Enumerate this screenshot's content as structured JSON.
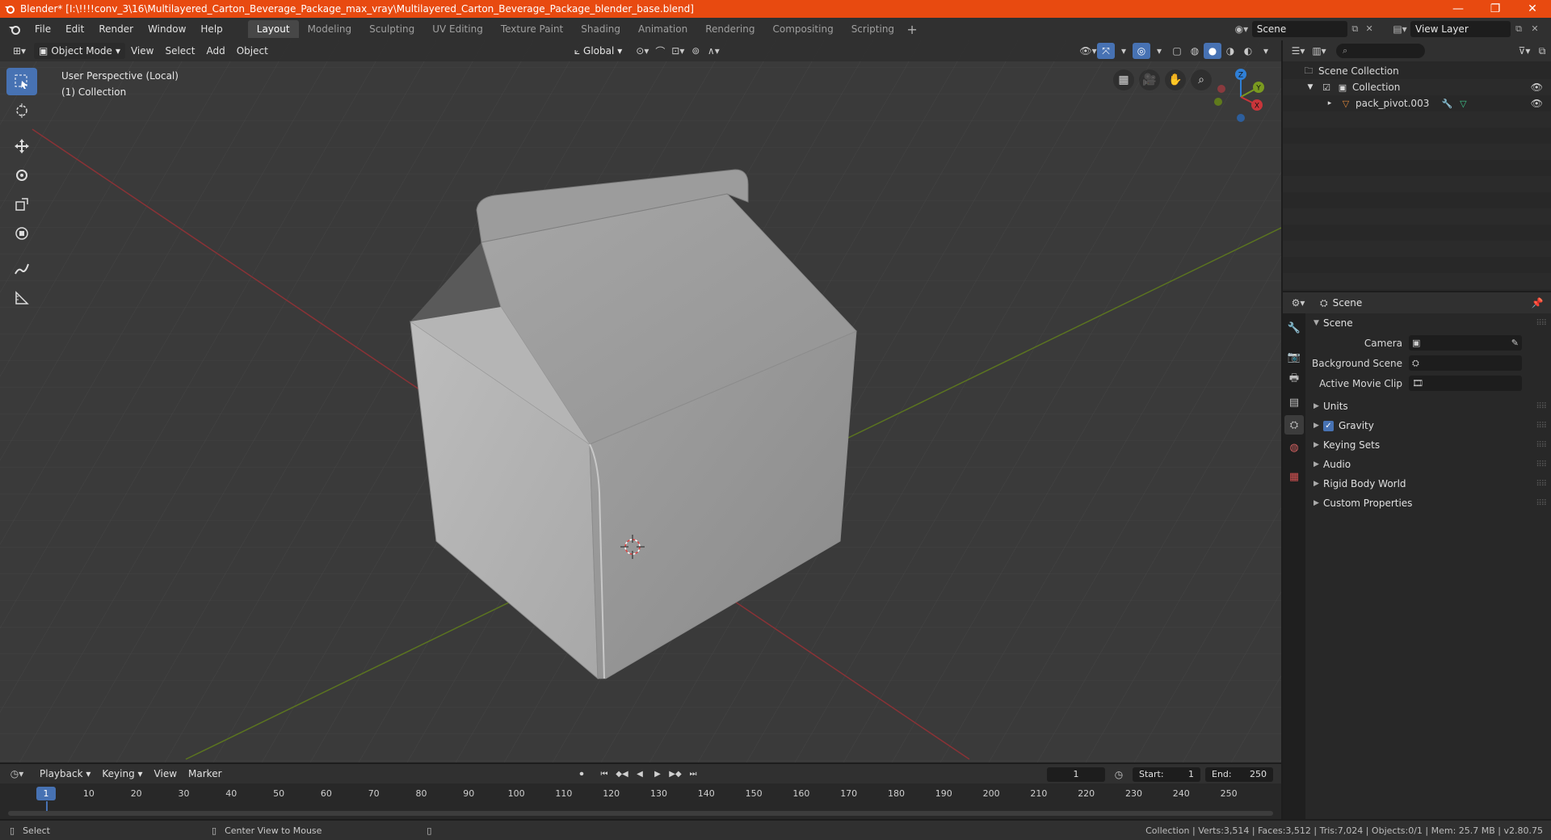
{
  "window": {
    "title": "Blender* [I:\\!!!!conv_3\\16\\Multilayered_Carton_Beverage_Package_max_vray\\Multilayered_Carton_Beverage_Package_blender_base.blend]",
    "controls": {
      "minimize": "—",
      "maximize": "❐",
      "close": "✕"
    }
  },
  "menubar": {
    "menus": [
      "File",
      "Edit",
      "Render",
      "Window",
      "Help"
    ],
    "workspaces": [
      "Layout",
      "Modeling",
      "Sculpting",
      "UV Editing",
      "Texture Paint",
      "Shading",
      "Animation",
      "Rendering",
      "Compositing",
      "Scripting"
    ],
    "active_workspace": "Layout",
    "add_label": "+",
    "scene": "Scene",
    "view_layer": "View Layer"
  },
  "viewport": {
    "mode": "Object Mode",
    "menus": [
      "View",
      "Select",
      "Add",
      "Object"
    ],
    "transform_orientation": "Global",
    "perspective_label": "User Perspective (Local)",
    "collection_label": "(1) Collection",
    "gizmo": {
      "x": "X",
      "y": "Y",
      "z": "Z"
    }
  },
  "outliner": {
    "search_placeholder": "",
    "rows": [
      {
        "label": "Scene Collection",
        "icon": "scene-collection-icon"
      },
      {
        "label": "Collection",
        "icon": "collection-icon"
      },
      {
        "label": "pack_pivot.003",
        "icon": "mesh-object-icon"
      }
    ]
  },
  "properties": {
    "context": "Scene",
    "panel_title": "Scene",
    "fields": [
      {
        "label": "Camera"
      },
      {
        "label": "Background Scene"
      },
      {
        "label": "Active Movie Clip"
      }
    ],
    "subpanels": [
      "Units",
      "Gravity",
      "Keying Sets",
      "Audio",
      "Rigid Body World",
      "Custom Properties"
    ],
    "gravity_checked": true
  },
  "timeline": {
    "menus": [
      "Playback",
      "Keying",
      "View",
      "Marker"
    ],
    "current_frame": "1",
    "start_label": "Start:",
    "start": "1",
    "end_label": "End:",
    "end": "250",
    "ticks": [
      "10",
      "20",
      "30",
      "40",
      "50",
      "60",
      "70",
      "80",
      "90",
      "100",
      "110",
      "120",
      "130",
      "140",
      "150",
      "160",
      "170",
      "180",
      "190",
      "200",
      "210",
      "220",
      "230",
      "240",
      "250"
    ],
    "playhead": "1"
  },
  "statusbar": {
    "left_action": "Select",
    "middle_action": "Center View to Mouse",
    "stats": "Collection | Verts:3,514 | Faces:3,512 | Tris:7,024 | Objects:0/1 | Mem: 25.7 MB | v2.80.75"
  },
  "colors": {
    "accent": "#4772b3",
    "titlebar": "#e84a10",
    "x_axis": "#c8353a",
    "y_axis": "#7a9a20",
    "z_axis": "#2f7fd6"
  }
}
